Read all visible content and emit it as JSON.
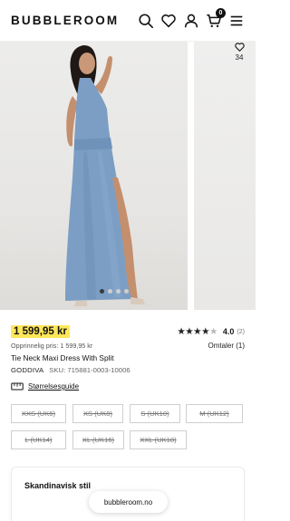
{
  "header": {
    "logo": "BUBBLEROOM",
    "cart_count": "0"
  },
  "gallery": {
    "favorite_count": "34",
    "dots_total": 4,
    "dots_active": 0
  },
  "product": {
    "price": "1 599,95 kr",
    "original_price": "Opprinnelig pris: 1 599,95 kr",
    "name": "Tie Neck Maxi Dress With Split",
    "brand": "GODDIVA",
    "sku": "SKU: 715881-0003-10006",
    "rating_value": "4.0",
    "rating_count": "(2)",
    "rating_stars": 4,
    "reviews_label": "Omtaler (1)"
  },
  "size_guide": {
    "label": "Størrelsesguide"
  },
  "sizes": [
    {
      "label": "XXS (UK6)"
    },
    {
      "label": "XS (UK8)"
    },
    {
      "label": "S (UK10)"
    },
    {
      "label": "M (UK12)"
    },
    {
      "label": "L (UK14)"
    },
    {
      "label": "XL (UK16)"
    },
    {
      "label": "XXL (UK18)"
    }
  ],
  "card": {
    "title": "Skandinavisk stil"
  },
  "browser": {
    "url": "bubbleroom.no"
  },
  "colors": {
    "price_highlight": "#ffe75a",
    "dress_blue": "#7c9ec4",
    "text": "#111111"
  }
}
